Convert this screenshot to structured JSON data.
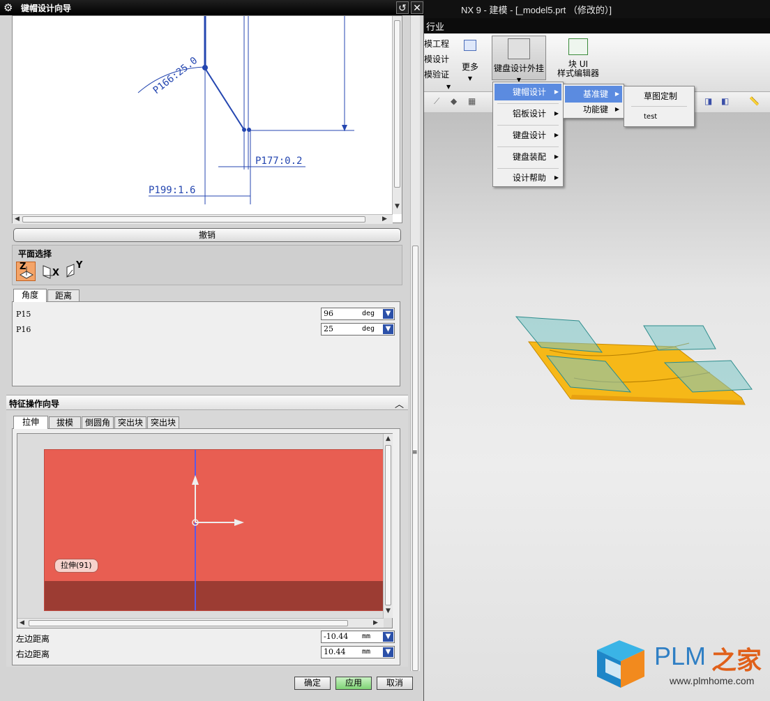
{
  "dialog": {
    "title": "键帽设计向导",
    "title_icon": "gear-icon",
    "undo_label": "撤销",
    "plane_section_title": "平面选择",
    "plane_icons": [
      "plane-z-icon",
      "plane-x-icon",
      "plane-y-icon"
    ],
    "plane_axis_labels": [
      "Z",
      "X",
      "Y"
    ],
    "sketch_labels": [
      "P166:25.0",
      "P177:0.2",
      "P199:1.6"
    ],
    "param_tabs": [
      "角度",
      "距离"
    ],
    "params": [
      {
        "label": "P15",
        "value": "96",
        "unit": "deg"
      },
      {
        "label": "P16",
        "value": "25",
        "unit": "deg"
      }
    ],
    "feature_section_title": "特征操作向导",
    "feature_tabs": [
      "拉伸",
      "拔模",
      "倒圆角",
      "突出块",
      "突出块"
    ],
    "preview_tag": "拉伸(91)",
    "distances": [
      {
        "label": "左边距离",
        "value": "-10.44",
        "unit": "mm"
      },
      {
        "label": "右边距离",
        "value": "10.44",
        "unit": "mm"
      }
    ],
    "buttons": {
      "ok": "确定",
      "apply": "应用",
      "cancel": "取消"
    },
    "colors": {
      "preview_fill": "#e85e52",
      "preview_dark": "#9c3c33",
      "accent_blue": "#2b50a8"
    }
  },
  "nx": {
    "title": "NX 9 - 建模 - [_model5.prt （修改的）]",
    "menubar_item": "行业",
    "ribbon_small_items": [
      "模工程",
      "模设计",
      "模验证"
    ],
    "ribbon_more": "更多",
    "ribbon_plugin": "键盘设计外挂",
    "ribbon_block_ui_line1": "块 UI",
    "ribbon_block_ui_line2": "样式编辑器",
    "menu1": [
      "键帽设计",
      "铝板设计",
      "键盘设计",
      "键盘装配",
      "设计帮助"
    ],
    "menu2": [
      "基准键",
      "功能键"
    ],
    "menu3": [
      "草图定制",
      "test"
    ],
    "colors": {
      "part_fill": "#f6b818",
      "plane_fill": "#7cc6c7",
      "menu_highlight": "#5b8be0"
    }
  },
  "watermark": {
    "brand": "PLM",
    "brand_cn": "之家",
    "url": "www.plmhome.com"
  }
}
